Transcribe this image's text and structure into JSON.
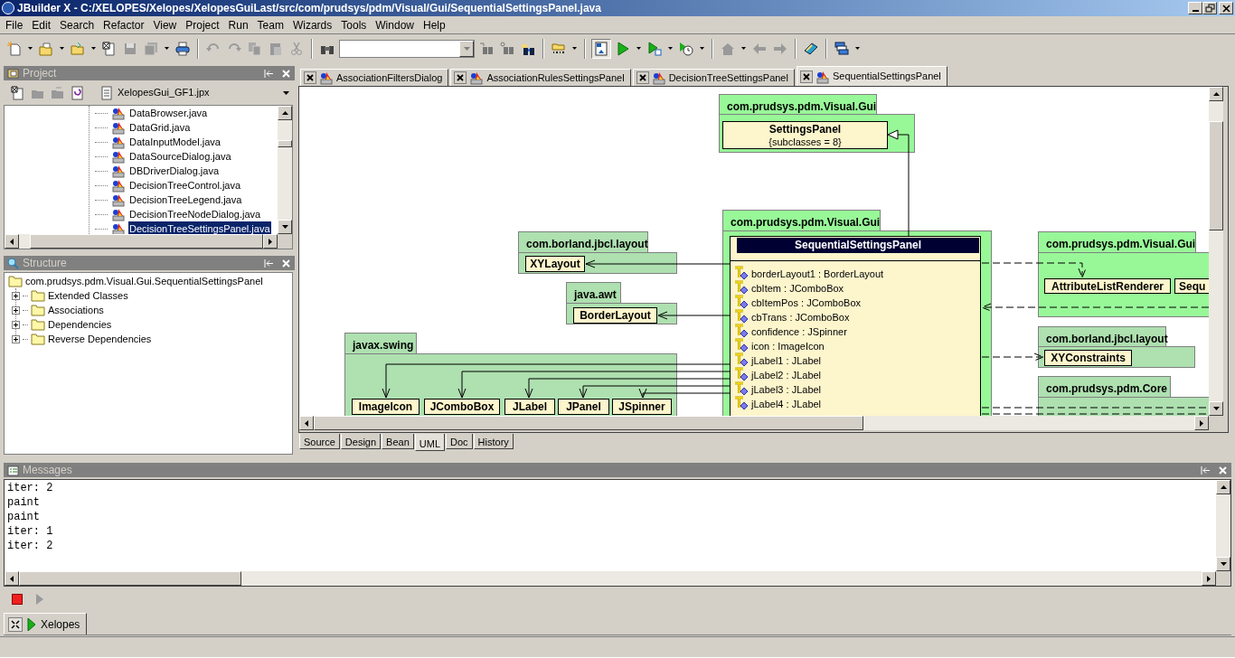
{
  "window": {
    "title": "JBuilder X - C:/XELOPES/Xelopes/XelopesGuiLast/src/com/prudsys/pdm/Visual/Gui/SequentialSettingsPanel.java"
  },
  "menu": [
    "File",
    "Edit",
    "Search",
    "Refactor",
    "View",
    "Project",
    "Run",
    "Team",
    "Wizards",
    "Tools",
    "Window",
    "Help"
  ],
  "project_panel": {
    "title": "Project",
    "project": "XelopesGui_GF1.jpx",
    "files": [
      {
        "name": "DataBrowser.java",
        "selected": false
      },
      {
        "name": "DataGrid.java",
        "selected": false
      },
      {
        "name": "DataInputModel.java",
        "selected": false
      },
      {
        "name": "DataSourceDialog.java",
        "selected": false
      },
      {
        "name": "DBDriverDialog.java",
        "selected": false
      },
      {
        "name": "DecisionTreeControl.java",
        "selected": false
      },
      {
        "name": "DecisionTreeLegend.java",
        "selected": false
      },
      {
        "name": "DecisionTreeNodeDialog.java",
        "selected": false
      },
      {
        "name": "DecisionTreeSettingsPanel.java",
        "selected": true
      }
    ]
  },
  "structure_panel": {
    "title": "Structure",
    "root": "com.prudsys.pdm.Visual.Gui.SequentialSettingsPanel",
    "children": [
      {
        "label": "Extended Classes",
        "expanded": false
      },
      {
        "label": "Associations",
        "expanded": false
      },
      {
        "label": "Dependencies",
        "expanded": false
      },
      {
        "label": "Reverse Dependencies",
        "expanded": false
      }
    ]
  },
  "editor_tabs": [
    {
      "label": "AssociationFiltersDialog",
      "selected": false
    },
    {
      "label": "AssociationRulesSettingsPanel",
      "selected": false
    },
    {
      "label": "DecisionTreeSettingsPanel",
      "selected": false
    },
    {
      "label": "SequentialSettingsPanel",
      "selected": true
    }
  ],
  "diagram": {
    "packages": [
      {
        "name": "com.prudsys.pdm.Visual.Gui",
        "color": "#98f898",
        "classes": [
          {
            "name": "SettingsPanel",
            "note": "{subclasses = 8}"
          }
        ]
      },
      {
        "name": "com.prudsys.pdm.Visual.Gui",
        "color": "#98f898",
        "classes": [
          {
            "name": "SequentialSettingsPanel",
            "attributes": [
              "borderLayout1 : BorderLayout",
              "cbItem : JComboBox",
              "cbItemPos : JComboBox",
              "cbTrans : JComboBox",
              "confidence : JSpinner",
              "icon : ImageIcon",
              "jLabel1 : JLabel",
              "jLabel2 : JLabel",
              "jLabel3 : JLabel",
              "jLabel4 : JLabel"
            ]
          }
        ]
      },
      {
        "name": "com.borland.jbcl.layout",
        "color": "#aee0b0",
        "classes": [
          {
            "name": "XYLayout"
          }
        ]
      },
      {
        "name": "java.awt",
        "color": "#aee0b0",
        "classes": [
          {
            "name": "BorderLayout"
          }
        ]
      },
      {
        "name": "javax.swing",
        "color": "#aee0b0",
        "classes": [
          {
            "name": "ImageIcon"
          },
          {
            "name": "JComboBox"
          },
          {
            "name": "JLabel"
          },
          {
            "name": "JPanel"
          },
          {
            "name": "JSpinner"
          }
        ]
      },
      {
        "name": "com.prudsys.pdm.Visual.Gui",
        "color": "#98f898",
        "classes": [
          {
            "name": "AttributeListRenderer"
          },
          {
            "name": "Sequ"
          }
        ]
      },
      {
        "name": "com.borland.jbcl.layout",
        "color": "#aee0b0",
        "classes": [
          {
            "name": "XYConstraints"
          }
        ]
      },
      {
        "name": "com.prudsys.pdm.Core",
        "color": "#aee0b0"
      }
    ]
  },
  "view_tabs": [
    {
      "label": "Source",
      "selected": false
    },
    {
      "label": "Design",
      "selected": false
    },
    {
      "label": "Bean",
      "selected": false
    },
    {
      "label": "UML",
      "selected": true
    },
    {
      "label": "Doc",
      "selected": false
    },
    {
      "label": "History",
      "selected": false
    }
  ],
  "messages": {
    "title": "Messages",
    "lines": [
      "iter: 2",
      "paint",
      "paint",
      "iter: 1",
      "iter: 2"
    ]
  },
  "run_tabs": [
    {
      "label": "Xelopes",
      "selected": true
    }
  ]
}
